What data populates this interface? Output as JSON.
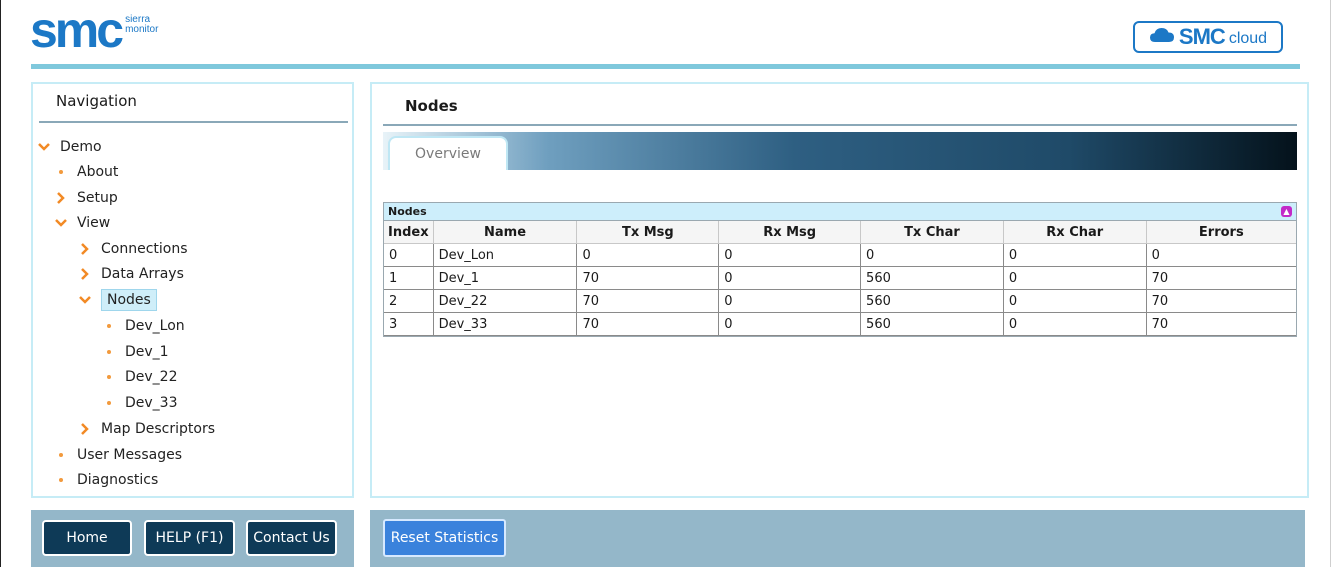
{
  "header": {
    "logo_text": "smc",
    "logo_sub1": "sierra",
    "logo_sub2": "monitor",
    "cloud_logo_smc": "SMC",
    "cloud_logo_cloud": "cloud",
    "brand_color": "#1c78c6"
  },
  "navigation": {
    "title": "Navigation",
    "items": [
      {
        "label": "Demo",
        "icon": "chevron-down-icon"
      },
      {
        "label": "About",
        "icon": "bullet-icon"
      },
      {
        "label": "Setup",
        "icon": "chevron-right-icon"
      },
      {
        "label": "View",
        "icon": "chevron-down-icon"
      },
      {
        "label": "Connections",
        "icon": "chevron-right-icon"
      },
      {
        "label": "Data Arrays",
        "icon": "chevron-right-icon"
      },
      {
        "label": "Nodes",
        "icon": "chevron-down-icon",
        "selected": true
      },
      {
        "label": "Dev_Lon",
        "icon": "bullet-icon"
      },
      {
        "label": "Dev_1",
        "icon": "bullet-icon"
      },
      {
        "label": "Dev_22",
        "icon": "bullet-icon"
      },
      {
        "label": "Dev_33",
        "icon": "bullet-icon"
      },
      {
        "label": "Map Descriptors",
        "icon": "chevron-right-icon"
      },
      {
        "label": "User Messages",
        "icon": "bullet-icon"
      },
      {
        "label": "Diagnostics",
        "icon": "bullet-icon"
      }
    ]
  },
  "content": {
    "title": "Nodes",
    "tabs": [
      {
        "label": "Overview",
        "active": true
      }
    ],
    "table": {
      "caption": "Nodes",
      "columns": [
        "Index",
        "Name",
        "Tx Msg",
        "Rx Msg",
        "Tx Char",
        "Rx Char",
        "Errors"
      ],
      "rows": [
        [
          "0",
          "Dev_Lon",
          "0",
          "0",
          "0",
          "0",
          "0"
        ],
        [
          "1",
          "Dev_1",
          "70",
          "0",
          "560",
          "0",
          "70"
        ],
        [
          "2",
          "Dev_22",
          "70",
          "0",
          "560",
          "0",
          "70"
        ],
        [
          "3",
          "Dev_33",
          "70",
          "0",
          "560",
          "0",
          "70"
        ]
      ]
    }
  },
  "footer": {
    "home": "Home",
    "help": "HELP (F1)",
    "contact": "Contact Us",
    "reset": "Reset Statistics"
  }
}
